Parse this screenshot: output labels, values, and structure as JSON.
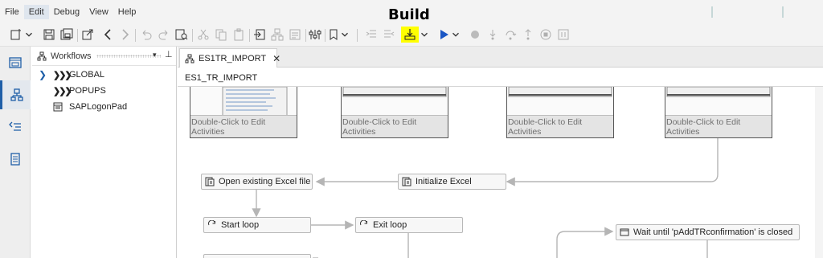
{
  "menu": {
    "items": [
      {
        "label": "File"
      },
      {
        "label": "Edit"
      },
      {
        "label": "Debug"
      },
      {
        "label": "View"
      },
      {
        "label": "Help"
      }
    ]
  },
  "annotation": {
    "build_label": "Build"
  },
  "toolbar": {
    "icons": [
      "new-icon",
      "dropdown-chevron-icon",
      "save-icon",
      "save-all-icon",
      "export-icon",
      "back-icon",
      "forward-icon",
      "undo-icon",
      "redo-icon",
      "find-icon",
      "cut-icon",
      "copy-icon",
      "paste-icon",
      "import-icon",
      "group-icon",
      "form-icon",
      "properties-icon",
      "bookmark-icon",
      "dropdown-chevron-icon",
      "indent-icon",
      "outdent-icon",
      "build-icon",
      "dropdown-chevron-icon",
      "run-icon",
      "dropdown-chevron-icon",
      "breakpoint-icon",
      "step-into-icon",
      "step-over-icon",
      "step-out-icon",
      "stop-icon",
      "pause-icon"
    ]
  },
  "activity_bar": {
    "items": [
      "window-icon",
      "workflow-tree-icon",
      "list-arrow-icon",
      "document-icon"
    ]
  },
  "workflows_panel": {
    "title": "Workflows",
    "items": [
      {
        "label": "GLOBAL",
        "icon": "chevron-group-icon",
        "expandable": true
      },
      {
        "label": "POPUPS",
        "icon": "chevron-group-icon",
        "expandable": false
      },
      {
        "label": "SAPLogonPad",
        "icon": "window-list-icon",
        "expandable": false
      }
    ]
  },
  "editor": {
    "tab_label": "ES1TR_IMPORT",
    "title": "ES1_TR_IMPORT",
    "thumbnails": [
      {
        "caption": "Double-Click to Edit Activities"
      },
      {
        "caption": "Double-Click to Edit Activities"
      },
      {
        "caption": "Double-Click to Edit Activities"
      },
      {
        "caption": "Double-Click to Edit Activities"
      }
    ],
    "nodes": {
      "open_excel": "Open existing Excel file",
      "init_excel": "Initialize Excel",
      "start_loop": "Start loop",
      "exit_loop": "Exit loop",
      "wait_until": "Wait until 'pAddTRconfirmation' is closed"
    }
  },
  "colors": {
    "highlight": "#ffff00",
    "accent": "#1f5fa8",
    "run_blue": "#1a56c4"
  }
}
